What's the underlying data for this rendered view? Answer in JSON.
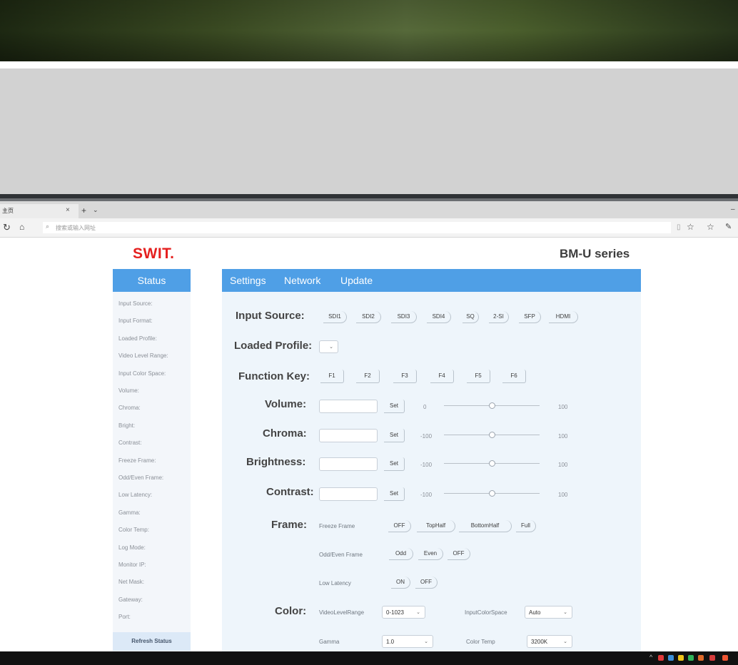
{
  "browser": {
    "tab_title": "主页",
    "address_placeholder": "搜索或输入网址"
  },
  "page": {
    "logo": "SWIT.",
    "series": "BM-U series"
  },
  "sidebar": {
    "title": "Status",
    "items": [
      "Input Source:",
      "Input Format:",
      "Loaded Profile:",
      "Video Level Range:",
      "Input Color Space:",
      "Volume:",
      "Chroma:",
      "Bright:",
      "Contrast:",
      "Freeze Frame:",
      "Odd/Even Frame:",
      "Low Latency:",
      "Gamma:",
      "Color Temp:",
      "Log Mode:",
      "Monitor IP:",
      "Net Mask:",
      "Gateway:",
      "Port:"
    ],
    "refresh": "Refresh Status"
  },
  "tabs": [
    "Settings",
    "Network",
    "Update"
  ],
  "settings": {
    "input_source": {
      "label": "Input Source:",
      "options": [
        "SDI1",
        "SDI2",
        "SDI3",
        "SDI4",
        "SQ",
        "2-SI",
        "SFP",
        "HDMI"
      ]
    },
    "loaded_profile": {
      "label": "Loaded Profile:",
      "value": ""
    },
    "function_key": {
      "label": "Function Key:",
      "keys": [
        "F1",
        "F2",
        "F3",
        "F4",
        "F5",
        "F6"
      ]
    },
    "volume": {
      "label": "Volume:",
      "set": "Set",
      "min": "0",
      "max": "100"
    },
    "chroma": {
      "label": "Chroma:",
      "set": "Set",
      "min": "-100",
      "max": "100"
    },
    "brightness": {
      "label": "Brightness:",
      "set": "Set",
      "min": "-100",
      "max": "100"
    },
    "contrast": {
      "label": "Contrast:",
      "set": "Set",
      "min": "-100",
      "max": "100"
    },
    "frame": {
      "label": "Frame:",
      "freeze_label": "Freeze Frame",
      "freeze_options": [
        "OFF",
        "TopHalf",
        "BottomHalf",
        "Full"
      ],
      "oddeven_label": "Odd/Even Frame",
      "oddeven_options": [
        "Odd",
        "Even",
        "OFF"
      ],
      "latency_label": "Low Latency",
      "latency_options": [
        "ON",
        "OFF"
      ]
    },
    "color": {
      "label": "Color:",
      "level_label": "VideoLevelRange",
      "level_value": "0-1023",
      "space_label": "InputColorSpace",
      "space_value": "Auto",
      "gamma_label": "Gamma",
      "gamma_value": "1.0",
      "temp_label": "Color Temp",
      "temp_value": "3200K"
    }
  }
}
